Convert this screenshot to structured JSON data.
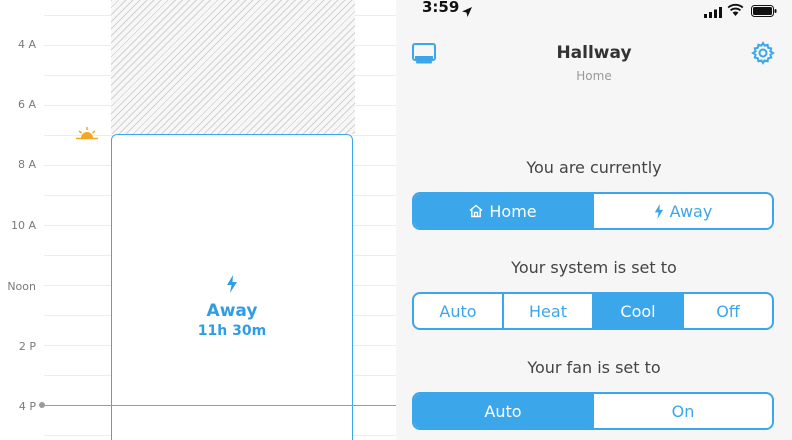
{
  "timeline": {
    "labels": [
      "4 A",
      "6 A",
      "8 A",
      "10 A",
      "Noon",
      "2 P",
      "4 P"
    ],
    "block": {
      "title": "Away",
      "duration": "11h 30m",
      "icon": "bolt-icon"
    },
    "sunrise_icon": "sunrise-icon"
  },
  "status_bar": {
    "time": "3:59"
  },
  "nav": {
    "title": "Hallway",
    "subtitle": "Home",
    "left_icon": "thermostat-device-icon",
    "right_icon": "gear-icon"
  },
  "mode_section": {
    "label": "You are currently",
    "options": [
      "Home",
      "Away"
    ],
    "selected": "Home"
  },
  "system_section": {
    "label": "Your system is set to",
    "options": [
      "Auto",
      "Heat",
      "Cool",
      "Off"
    ],
    "selected": "Cool"
  },
  "fan_section": {
    "label": "Your fan is set to",
    "options": [
      "Auto",
      "On"
    ],
    "selected": "Auto"
  },
  "colors": {
    "accent": "#3ca6ea",
    "sun": "#f5a623"
  }
}
